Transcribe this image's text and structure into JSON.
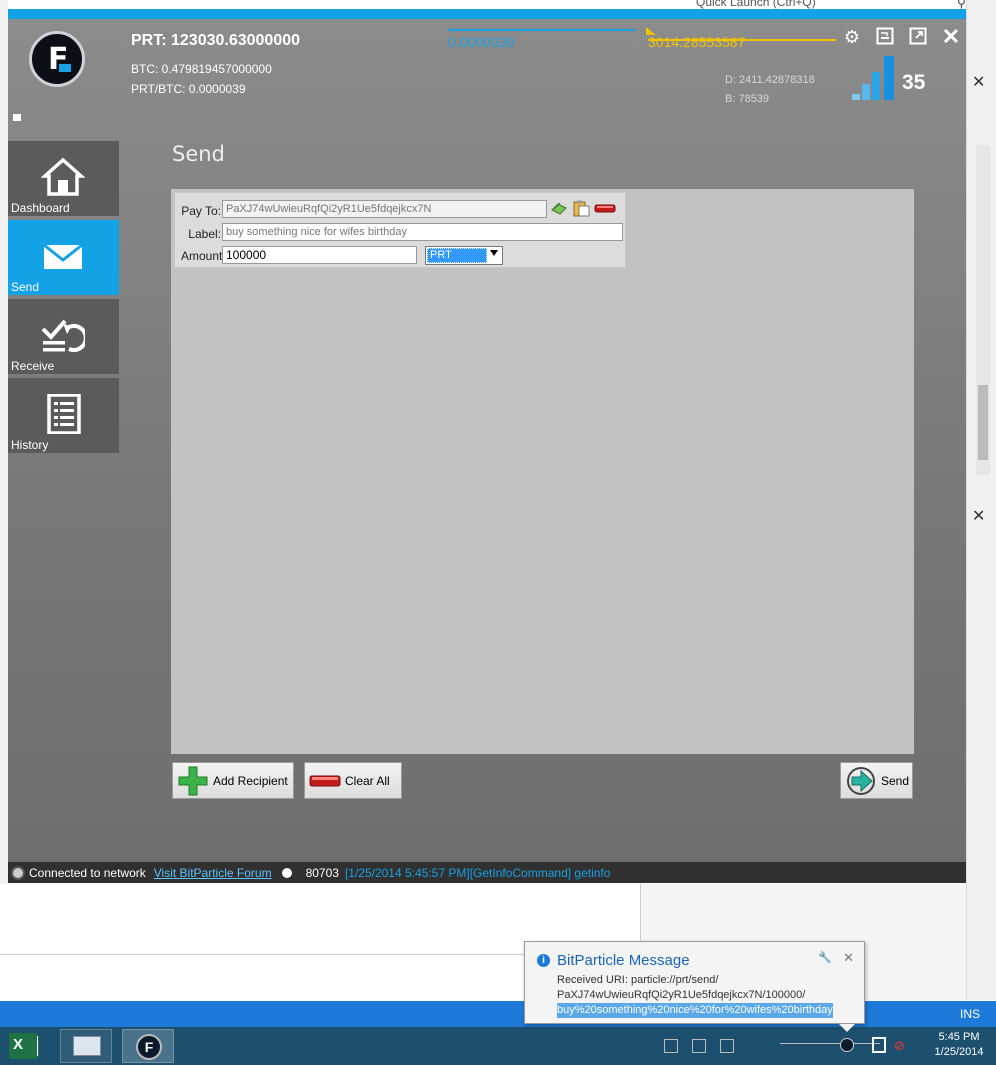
{
  "background": {
    "quick_launch": "Quick Launch (Ctrl+Q)",
    "excel_status_right": "INS"
  },
  "app": {
    "balance_main": "PRT: 123030.63000000",
    "btc_balance": "BTC: 0.479819457000000",
    "rate": "PRT/BTC: 0.0000039",
    "ticker_blue": "0.0000039",
    "ticker_gold": "3014.28553587",
    "difficulty": "D: 2411.42878318",
    "blocks_short": "B: 78539",
    "connections": "35",
    "colors": {
      "accent": "#14a2e6",
      "gold": "#f2c200",
      "panel": "#c2c2c2"
    }
  },
  "nav": {
    "items": [
      {
        "label": "Dashboard",
        "icon": "home-icon"
      },
      {
        "label": "Send",
        "icon": "envelope-icon"
      },
      {
        "label": "Receive",
        "icon": "receive-icon"
      },
      {
        "label": "History",
        "icon": "history-icon"
      }
    ]
  },
  "send": {
    "title": "Send",
    "pay_to_label": "Pay To:",
    "pay_to_value": "PaXJ74wUwieuRqfQi2yR1Ue5fdqejkcx7N",
    "label_label": "Label:",
    "label_value": "buy something nice for wifes birthday",
    "amount_label": "Amount:",
    "amount_value": "100000",
    "unit_value": "PRT",
    "add_recipient": "Add Recipient",
    "clear_all": "Clear All",
    "send_button": "Send"
  },
  "statusbar": {
    "connected": "Connected to network",
    "forum_link": "Visit BitParticle Forum",
    "blocks": "80703",
    "log": "[1/25/2014 5:45:57 PM][GetInfoCommand] getinfo"
  },
  "balloon": {
    "title": "BitParticle Message",
    "line1": "Received URI: particle://prt/send/",
    "line2": "PaXJ74wUwieuRqfQi2yR1Ue5fdqejkcx7N/100000/",
    "line3": "buy%20something%20nice%20for%20wifes%20birthday"
  },
  "taskbar": {
    "time": "5:45 PM",
    "date": "1/25/2014"
  }
}
